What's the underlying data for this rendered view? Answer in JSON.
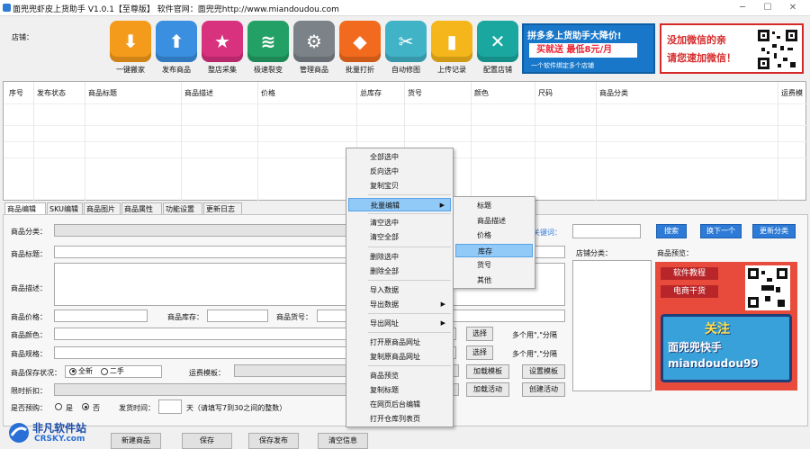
{
  "window": {
    "title": "面兜兜虾皮上货助手 V1.0.1【至尊版】  软件官网：面兜兜http://www.miandoudou.com",
    "min": "─",
    "max": "☐",
    "close": "✕"
  },
  "shop_label": "店铺：",
  "toolbar": [
    {
      "label": "一键搬家",
      "icon": "download-cloud-icon",
      "color": "#f59b1c"
    },
    {
      "label": "发布商品",
      "icon": "upload-cloud-icon",
      "color": "#3a8fe0"
    },
    {
      "label": "整店采集",
      "icon": "star-icon",
      "color": "#d8317e"
    },
    {
      "label": "极速裂变",
      "icon": "layers-icon",
      "color": "#23a065"
    },
    {
      "label": "管理商品",
      "icon": "gear-icon",
      "color": "#7b8288"
    },
    {
      "label": "批量打折",
      "icon": "tag-icon",
      "color": "#f26a1d"
    },
    {
      "label": "自动修图",
      "icon": "scissors-icon",
      "color": "#41b3c7"
    },
    {
      "label": "上传记录",
      "icon": "bookmark-icon",
      "color": "#f4b61a"
    },
    {
      "label": "配置店铺",
      "icon": "tools-icon",
      "color": "#1aa7a0"
    }
  ],
  "banner1": {
    "line1": "拼多多上货助手大降价!",
    "line2": "买就送  最低8元/月",
    "line3": "一个软件绑定多个店铺"
  },
  "banner2": {
    "line1": "没加微信的亲",
    "line2": "请您速加微信！"
  },
  "grid": {
    "columns": [
      "序号",
      "发布状态",
      "商品标题",
      "商品描述",
      "价格",
      "总库存",
      "货号",
      "颜色",
      "尺码",
      "商品分类",
      "运费模"
    ]
  },
  "tabs": [
    "商品编辑",
    "SKU编辑",
    "商品图片",
    "商品属性",
    "功能设置",
    "更新日志"
  ],
  "form": {
    "category": "商品分类：",
    "title": "商品标题：",
    "desc": "商品描述：",
    "price": "商品价格：",
    "stock": "商品库存：",
    "sku": "商品货号：",
    "color": "商品颜色：",
    "spec": "商品规格：",
    "condition": "商品保存状况：",
    "cond_new": "全新",
    "cond_used": "二手",
    "shipping": "运费模板：",
    "discount": "限时折扣：",
    "preorder": "是否预购：",
    "yes": "是",
    "no": "否",
    "ship_time": "发货时间：",
    "ship_hint": "天（请填写7到30之间的整数）",
    "keyword": "关键词：",
    "store_cat": "店铺分类：",
    "preview": "商品预览：",
    "select": "选择",
    "multi_hint": "多个用\",\"分隔",
    "load_tpl": "加载模板",
    "set_tpl": "设置模板",
    "load_act": "加载活动",
    "create_act": "创建活动",
    "search": "搜索",
    "next": "换下一个",
    "update_cat": "更新分类"
  },
  "bottom_buttons": [
    "新建商品",
    "保存",
    "保存发布",
    "清空信息"
  ],
  "context_menu": [
    "全部选中",
    "反向选中",
    "复制宝贝",
    "批量编辑",
    "清空选中",
    "清空全部",
    "删除选中",
    "删除全部",
    "导入数据",
    "导出数据",
    "导出网址",
    "打开原商品网址",
    "复制原商品网址",
    "商品预览",
    "复制标题",
    "在网页后台编辑",
    "打开仓库列表页"
  ],
  "submenu": [
    "标题",
    "商品描述",
    "价格",
    "库存",
    "货号",
    "其他"
  ],
  "promo": {
    "tag1": "软件教程",
    "tag2": "电商干货",
    "follow": "关注",
    "name": "面兜兜快手",
    "id": "miandoudou99"
  },
  "watermark": {
    "cn": "非凡软件站",
    "en": "CRSKY.com"
  }
}
